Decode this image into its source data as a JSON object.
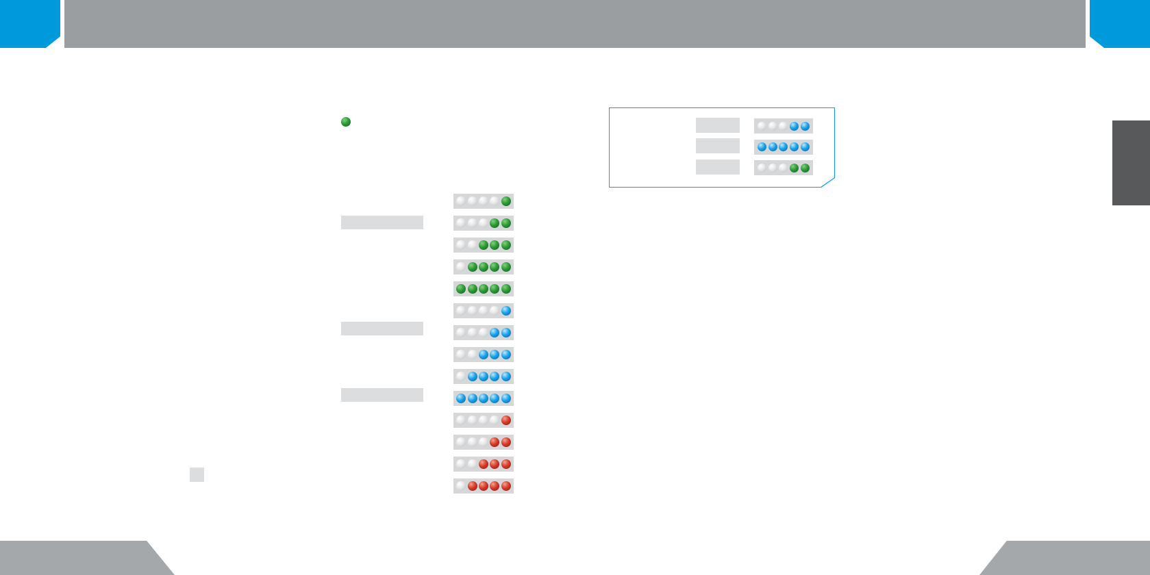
{
  "colors": {
    "accent_blue": "#0099dc",
    "header_gray": "#9b9ea1",
    "footer_gray": "#a5a8ab",
    "side_tab_dark": "#58595b",
    "label_fill": "#dcdddf",
    "strip_fill": "#d6d7d9"
  },
  "legend": {
    "icon": "green-led-icon"
  },
  "indicator_strips": [
    {
      "color": "green",
      "lit": 1
    },
    {
      "color": "green",
      "lit": 2
    },
    {
      "color": "green",
      "lit": 3
    },
    {
      "color": "green",
      "lit": 4
    },
    {
      "color": "green",
      "lit": 5
    },
    {
      "color": "blue",
      "lit": 1
    },
    {
      "color": "blue",
      "lit": 2
    },
    {
      "color": "blue",
      "lit": 3
    },
    {
      "color": "blue",
      "lit": 4
    },
    {
      "color": "blue",
      "lit": 5
    },
    {
      "color": "red",
      "lit": 1
    },
    {
      "color": "red",
      "lit": 2
    },
    {
      "color": "red",
      "lit": 3
    },
    {
      "color": "red",
      "lit": 4
    }
  ],
  "info_box": {
    "strips": [
      {
        "color": "blue",
        "lit": 2
      },
      {
        "color": "blue",
        "lit": 5
      },
      {
        "color": "green",
        "lit": 2
      }
    ]
  }
}
